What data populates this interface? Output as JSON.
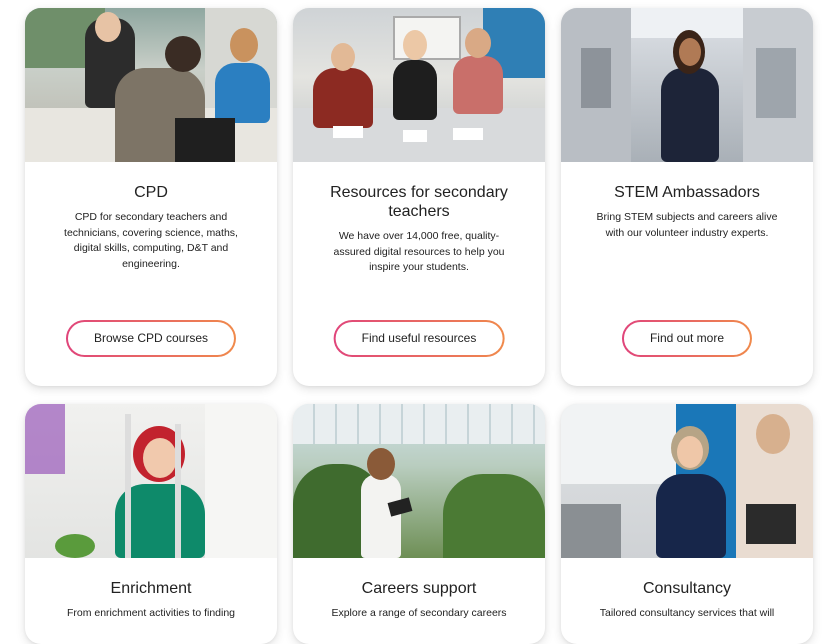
{
  "cards": [
    {
      "title": "CPD",
      "desc": "CPD for secondary teachers and technicians, covering science, maths, digital skills, computing, D&T and engineering.",
      "button": "Browse CPD courses",
      "image": "classroom-teachers-photo"
    },
    {
      "title": "Resources for secondary teachers",
      "desc": "We have over 14,000 free, quality-assured digital resources to help you inspire your students.",
      "button": "Find useful resources",
      "image": "workshop-table-photo"
    },
    {
      "title": "STEM Ambassadors",
      "desc": "Bring STEM subjects and careers alive with our volunteer industry experts.",
      "button": "Find out more",
      "image": "space-station-photo"
    },
    {
      "title": "Enrichment",
      "desc": "From enrichment activities to finding",
      "image": "lab-experiment-photo"
    },
    {
      "title": "Careers support",
      "desc": "Explore a range of secondary careers",
      "image": "greenhouse-photo"
    },
    {
      "title": "Consultancy",
      "desc": "Tailored consultancy services that will",
      "image": "presenter-photo"
    }
  ],
  "colors": {
    "button_gradient_start": "#e0457b",
    "button_gradient_end": "#f08a4b"
  }
}
